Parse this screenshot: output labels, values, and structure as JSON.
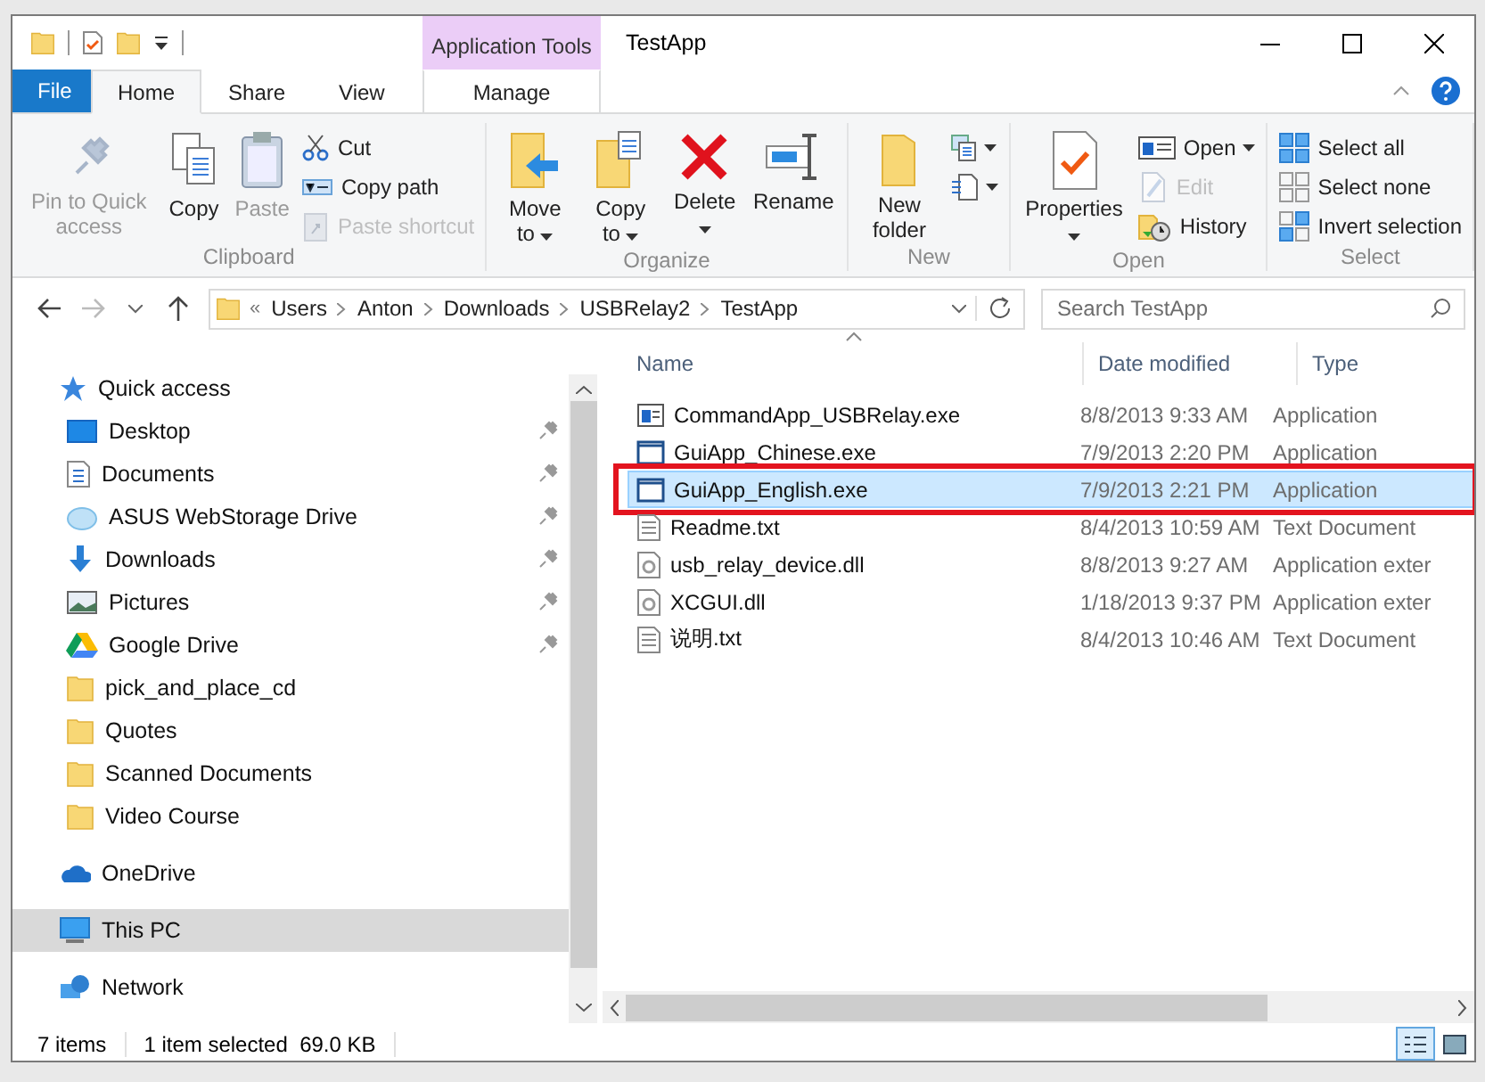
{
  "window": {
    "title": "TestApp"
  },
  "quick_access_toolbar": {
    "items": [
      {
        "kind": "folder"
      },
      {
        "kind": "properties"
      },
      {
        "kind": "newfolder"
      },
      {
        "kind": "customize"
      }
    ]
  },
  "context_tab": {
    "group": "Application Tools",
    "tab": {
      "label": "Manage",
      "selected": false
    }
  },
  "tabs": [
    {
      "label": "File",
      "kind": "file",
      "selected": false
    },
    {
      "label": "Home",
      "kind": "tab",
      "selected": true
    },
    {
      "label": "Share",
      "kind": "tab",
      "selected": false
    },
    {
      "label": "View",
      "kind": "tab",
      "selected": false
    }
  ],
  "ribbon": {
    "groups": [
      {
        "label": "Clipboard",
        "large": [
          {
            "label": "Pin to Quick access",
            "disabled": true,
            "dropdown": false
          },
          {
            "label": "Copy",
            "disabled": false,
            "dropdown": false
          },
          {
            "label": "Paste",
            "disabled": true,
            "dropdown": false
          }
        ],
        "small": [
          {
            "label": "Cut",
            "disabled": false,
            "dropdown": false
          },
          {
            "label": "Copy path",
            "disabled": false,
            "dropdown": false
          },
          {
            "label": "Paste shortcut",
            "disabled": true,
            "dropdown": false
          }
        ]
      },
      {
        "label": "Organize",
        "large": [
          {
            "label": "Move to",
            "disabled": false,
            "dropdown": true
          },
          {
            "label": "Copy to",
            "disabled": false,
            "dropdown": true
          },
          {
            "label": "Delete",
            "disabled": false,
            "dropdown": true
          },
          {
            "label": "Rename",
            "disabled": false,
            "dropdown": false
          }
        ]
      },
      {
        "label": "New",
        "large": [
          {
            "label": "New folder",
            "disabled": false,
            "dropdown": false
          }
        ],
        "small": [
          {
            "disabled": false,
            "dropdown": true
          },
          {
            "disabled": false,
            "dropdown": true
          }
        ]
      },
      {
        "label": "Open",
        "large": [
          {
            "label": "Properties",
            "disabled": false,
            "dropdown": true
          }
        ],
        "small": [
          {
            "label": "Open",
            "disabled": false,
            "dropdown": true
          },
          {
            "label": "Edit",
            "disabled": true,
            "dropdown": false
          },
          {
            "label": "History",
            "disabled": false,
            "dropdown": false
          }
        ]
      },
      {
        "label": "Select",
        "small": [
          {
            "label": "Select all",
            "disabled": false,
            "dropdown": false
          },
          {
            "label": "Select none",
            "disabled": false,
            "dropdown": false
          },
          {
            "label": "Invert selection",
            "disabled": false,
            "dropdown": false
          }
        ]
      }
    ]
  },
  "address_bar": {
    "overflow": "«",
    "crumbs": [
      "Users",
      "Anton",
      "Downloads",
      "USBRelay2",
      "TestApp"
    ],
    "forward_disabled": true
  },
  "search": {
    "placeholder": "Search TestApp"
  },
  "navigation": {
    "items": [
      {
        "label": "Quick access",
        "selected": false,
        "children": [
          {
            "label": "Desktop",
            "pinned": true,
            "selected": false
          },
          {
            "label": "Documents",
            "pinned": true,
            "selected": false
          },
          {
            "label": "ASUS WebStorage Drive",
            "pinned": true,
            "selected": false
          },
          {
            "label": "Downloads",
            "pinned": true,
            "selected": false
          },
          {
            "label": "Pictures",
            "pinned": true,
            "selected": false
          },
          {
            "label": "Google Drive",
            "pinned": true,
            "selected": false
          },
          {
            "label": "pick_and_place_cd",
            "pinned": false,
            "selected": false
          },
          {
            "label": "Quotes",
            "pinned": false,
            "selected": false
          },
          {
            "label": "Scanned Documents",
            "pinned": false,
            "selected": false
          },
          {
            "label": "Video Course",
            "pinned": false,
            "selected": false
          }
        ]
      },
      {
        "label": "OneDrive",
        "selected": false
      },
      {
        "label": "This PC",
        "selected": true
      },
      {
        "label": "Network",
        "selected": false
      }
    ]
  },
  "file_list": {
    "columns": [
      "Name",
      "Date modified",
      "Type"
    ],
    "rows": [
      {
        "kind": "console",
        "name": "CommandApp_USBRelay.exe",
        "date": "8/8/2013 9:33 AM",
        "type": "Application",
        "selected": false,
        "highlighted": false
      },
      {
        "kind": "app",
        "name": "GuiApp_Chinese.exe",
        "date": "7/9/2013 2:20 PM",
        "type": "Application",
        "selected": false,
        "highlighted": false
      },
      {
        "kind": "app",
        "name": "GuiApp_English.exe",
        "date": "7/9/2013 2:21 PM",
        "type": "Application",
        "selected": true,
        "highlighted": true
      },
      {
        "kind": "text",
        "name": "Readme.txt",
        "date": "8/4/2013 10:59 AM",
        "type": "Text Document",
        "selected": false,
        "highlighted": false
      },
      {
        "kind": "dll",
        "name": "usb_relay_device.dll",
        "date": "8/8/2013 9:27 AM",
        "type": "Application exter",
        "selected": false,
        "highlighted": false
      },
      {
        "kind": "dll",
        "name": "XCGUI.dll",
        "date": "1/18/2013 9:37 PM",
        "type": "Application exter",
        "selected": false,
        "highlighted": false
      },
      {
        "kind": "text",
        "name": "说明.txt",
        "date": "8/4/2013 10:46 AM",
        "type": "Text Document",
        "selected": false,
        "highlighted": false
      }
    ]
  },
  "status_bar": {
    "count": "7 items",
    "selection": "1 item selected  69.0 KB",
    "views": [
      {
        "kind": "details",
        "selected": true
      },
      {
        "kind": "large",
        "selected": false
      }
    ]
  }
}
